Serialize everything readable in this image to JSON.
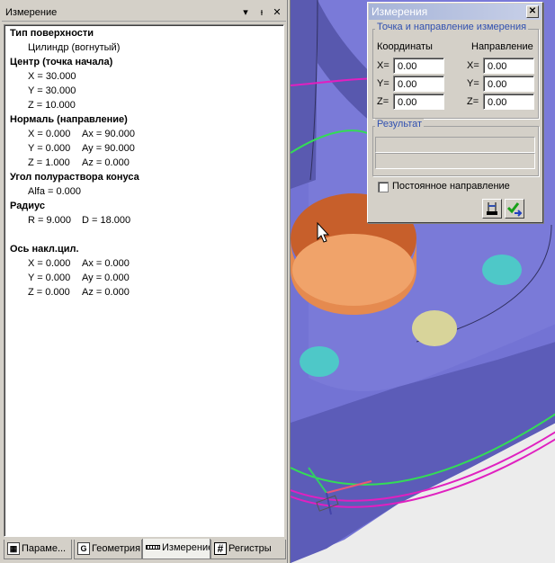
{
  "panel": {
    "title": "Измерение",
    "header_buttons": [
      "▾",
      "ᵼ",
      "✕"
    ],
    "info": {
      "surface_type_heading": "Тип поверхности",
      "surface_type": "Цилиндр (вогнутый)",
      "center_heading": "Центр (точка начала)",
      "center_x": "X = 30.000",
      "center_y": "Y = 30.000",
      "center_z": "Z = 10.000",
      "normal_heading": "Нормаль (направление)",
      "normal_x": "X = 0.000",
      "normal_ax": "Ax = 90.000",
      "normal_y": "Y = 0.000",
      "normal_ay": "Ay = 90.000",
      "normal_z": "Z = 1.000",
      "normal_az": "Az = 0.000",
      "cone_heading": "Угол полураствора конуса",
      "cone_alfa": "Alfa = 0.000",
      "radius_heading": "Радиус",
      "radius_r": "R = 9.000",
      "radius_d": "D = 18.000",
      "axis_heading": "Ось накл.цил.",
      "axis_x": "X = 0.000",
      "axis_ax": "Ax = 0.000",
      "axis_y": "Y = 0.000",
      "axis_ay": "Ay = 0.000",
      "axis_z": "Z = 0.000",
      "axis_az": "Az = 0.000"
    },
    "tabs": [
      {
        "label": "Параме...",
        "icon": "parameters-icon"
      },
      {
        "label": "Геометрия",
        "icon": "geometry-icon",
        "icon_letter": "G"
      },
      {
        "label": "Измерение",
        "icon": "ruler-icon"
      },
      {
        "label": "Регистры",
        "icon": "hash-icon",
        "icon_letter": "#"
      }
    ]
  },
  "dialog": {
    "title": "Измерения",
    "close": "✕",
    "group_title": "Точка и направление измерения",
    "coords_label": "Координаты",
    "direction_label": "Направление",
    "x_label": "X=",
    "y_label": "Y=",
    "z_label": "Z=",
    "coord_x": "0.00",
    "coord_y": "0.00",
    "coord_z": "0.00",
    "dir_x": "0.00",
    "dir_y": "0.00",
    "dir_z": "0.00",
    "result_title": "Результат",
    "checkbox_label": "Постоянное направление"
  },
  "colors": {
    "part": "#7777d6",
    "part_dark": "#5a5ab4",
    "hole_orange": "#d9743f",
    "hole_cyan": "#55d6d6",
    "hole_yellow": "#d8d49a",
    "curve_green": "#33dd55",
    "curve_magenta": "#e020c0",
    "legend_blue": "#3050b0"
  }
}
